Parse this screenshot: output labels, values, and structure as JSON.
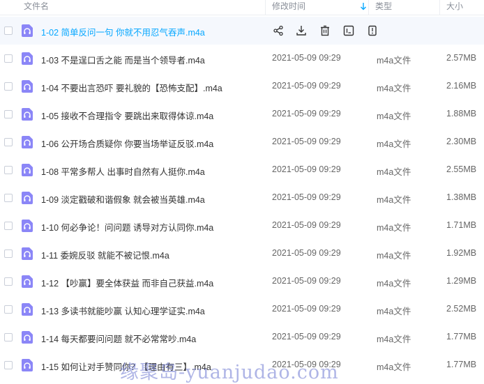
{
  "header": {
    "name": "文件名",
    "time": "修改时间",
    "type": "类型",
    "size": "大小",
    "sort_icon": "arrow-down-icon",
    "sort_color": "#06a7ff"
  },
  "colors": {
    "accent": "#06a7ff",
    "file_icon": "#8b86f7",
    "hover_row": "#f5f8fd"
  },
  "hover_actions": [
    "share-icon",
    "download-icon",
    "delete-icon",
    "rename-icon",
    "more-icon"
  ],
  "files": [
    {
      "name": "1-02 简单反问一句 你就不用忍气吞声.m4a",
      "time": "",
      "type": "",
      "size": "",
      "hover": true
    },
    {
      "name": "1-03 不是逞口舌之能 而是当个领导者.m4a",
      "time": "2021-05-09 09:29",
      "type": "m4a文件",
      "size": "2.57MB"
    },
    {
      "name": "1-04 不要出言恐吓 要礼貌的【恐怖支配】.m4a",
      "time": "2021-05-09 09:29",
      "type": "m4a文件",
      "size": "2.16MB"
    },
    {
      "name": "1-05 接收不合理指令 要跳出来取得体谅.m4a",
      "time": "2021-05-09 09:29",
      "type": "m4a文件",
      "size": "1.88MB"
    },
    {
      "name": "1-06 公开场合质疑你 你要当场举证反驳.m4a",
      "time": "2021-05-09 09:29",
      "type": "m4a文件",
      "size": "2.30MB"
    },
    {
      "name": "1-08 平常多帮人 出事时自然有人挺你.m4a",
      "time": "2021-05-09 09:29",
      "type": "m4a文件",
      "size": "2.55MB"
    },
    {
      "name": "1-09 淡定戳破和谐假象 就会被当英雄.m4a",
      "time": "2021-05-09 09:29",
      "type": "m4a文件",
      "size": "1.38MB"
    },
    {
      "name": "1-10 何必争论！问问题 诱导对方认同你.m4a",
      "time": "2021-05-09 09:29",
      "type": "m4a文件",
      "size": "1.71MB"
    },
    {
      "name": "1-11 委婉反驳 就能不被记恨.m4a",
      "time": "2021-05-09 09:29",
      "type": "m4a文件",
      "size": "1.92MB"
    },
    {
      "name": "1-12 【吵赢】要全体获益 而非自己获益.m4a",
      "time": "2021-05-09 09:29",
      "type": "m4a文件",
      "size": "1.29MB"
    },
    {
      "name": "1-13 多读书就能吵赢 认知心理学证实.m4a",
      "time": "2021-05-09 09:29",
      "type": "m4a文件",
      "size": "2.52MB"
    },
    {
      "name": "1-14 每天都要问问题 就不必常常吵.m4a",
      "time": "2021-05-09 09:29",
      "type": "m4a文件",
      "size": "1.77MB"
    },
    {
      "name": "1-15 如何让对手赞同你？【理由有三】.m4a",
      "time": "2021-05-09 09:29",
      "type": "m4a文件",
      "size": "1.77MB"
    }
  ],
  "watermark": "缘聚岛-yuanjudao.com"
}
